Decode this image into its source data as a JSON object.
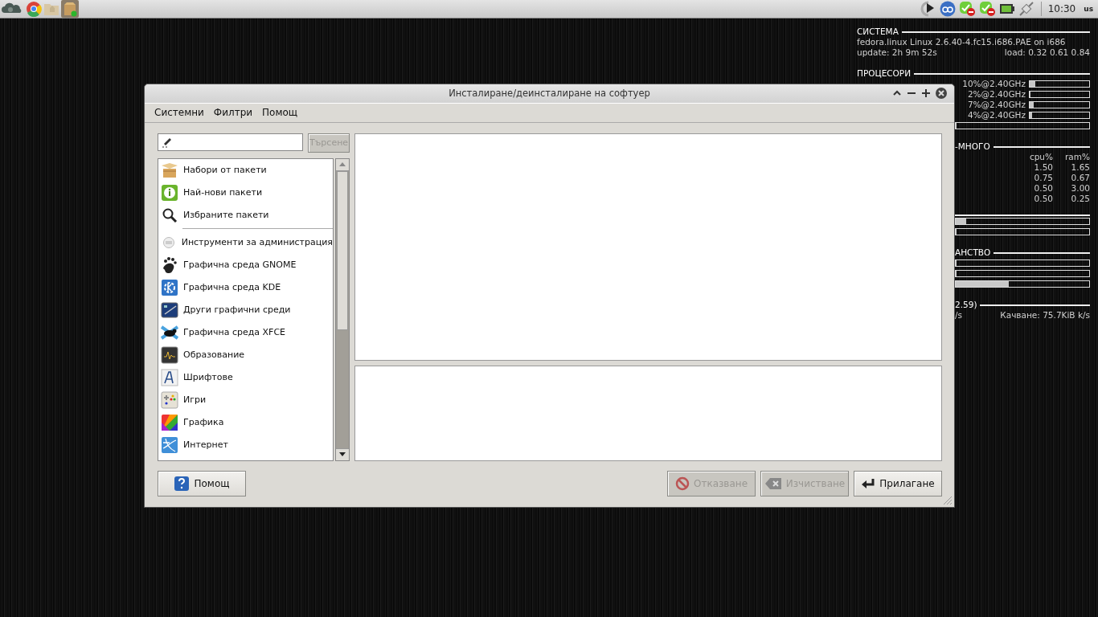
{
  "top_panel": {
    "clock": "10:30",
    "keyboard_layout": "us"
  },
  "conky": {
    "lines": [
      {
        "kind": "heading",
        "text": "СИСТЕМА"
      },
      {
        "kind": "text",
        "text": "fedora.linux Linux 2.6.40-4.fc15.i686.PAE on i686"
      },
      {
        "kind": "pair",
        "left": "update: 2h 9m 52s",
        "right": "load: 0.32 0.61 0.84"
      },
      {
        "kind": "heading",
        "text": "ПРОЦЕСОРИ"
      },
      {
        "kind": "bar",
        "label": "10%@2.40GHz",
        "level": 0.1
      },
      {
        "kind": "bar",
        "label": "2%@2.40GHz",
        "level": 0.02
      },
      {
        "kind": "bar",
        "label": "7%@2.40GHz",
        "level": 0.07
      },
      {
        "kind": "bar",
        "label": "4%@2.40GHz",
        "level": 0.04
      },
      {
        "kind": "bar",
        "level": 0
      },
      {
        "kind": "heading",
        "text": "-МНОГО"
      },
      {
        "kind": "columns",
        "cells": [
          "cpu%",
          "ram%"
        ]
      },
      {
        "kind": "columns",
        "cells": [
          "1.50",
          "1.65"
        ]
      },
      {
        "kind": "columns",
        "cells": [
          "0.75",
          "0.67"
        ]
      },
      {
        "kind": "columns",
        "cells": [
          "0.50",
          "3.00"
        ]
      },
      {
        "kind": "columns",
        "cells": [
          "0.50",
          "0.25"
        ]
      },
      {
        "kind": "heading"
      },
      {
        "kind": "bar",
        "level": 0.08
      },
      {
        "kind": "bar",
        "level": 0
      },
      {
        "kind": "heading",
        "text": "АНСТВО"
      },
      {
        "kind": "bar",
        "level": 0
      },
      {
        "kind": "bar",
        "level": 0
      },
      {
        "kind": "bar",
        "level": 0.4
      },
      {
        "kind": "heading",
        "text": "2.59)"
      },
      {
        "kind": "pair",
        "left": "/s",
        "right": "Качване: 75.7KiB k/s"
      }
    ]
  },
  "window": {
    "title": "Инсталиране/деинсталиране на софтуер",
    "menu": [
      "Системни",
      "Филтри",
      "Помощ"
    ],
    "search": {
      "button": {
        "label": "Търсене",
        "disabled": true
      }
    },
    "groups": [
      {
        "label": "Набори от пакети",
        "separator_after": false
      },
      {
        "label": "Най-нови пакети",
        "separator_after": false
      },
      {
        "label": "Избраните пакети",
        "separator_after": true
      },
      {
        "label": "Инструменти за администрация",
        "separator_after": false
      },
      {
        "label": "Графична среда GNOME",
        "separator_after": false
      },
      {
        "label": "Графична среда KDE",
        "separator_after": false
      },
      {
        "label": "Други графични среди",
        "separator_after": false
      },
      {
        "label": "Графична среда XFCE",
        "separator_after": false
      },
      {
        "label": "Образование",
        "separator_after": false
      },
      {
        "label": "Шрифтове",
        "separator_after": false
      },
      {
        "label": "Игри",
        "separator_after": false
      },
      {
        "label": "Графика",
        "separator_after": false
      },
      {
        "label": "Интернет",
        "separator_after": false
      }
    ],
    "buttons": [
      {
        "kind": "help",
        "label": "Помощ",
        "disabled": false
      },
      {
        "kind": "cancel",
        "label": "Отказване",
        "disabled": true
      },
      {
        "kind": "clear",
        "label": "Изчистване",
        "disabled": true
      },
      {
        "kind": "apply",
        "label": "Прилагане",
        "disabled": false
      }
    ]
  }
}
